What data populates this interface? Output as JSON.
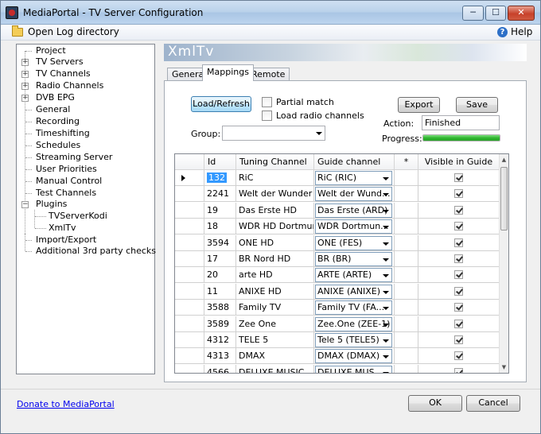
{
  "window": {
    "title": "MediaPortal - TV Server Configuration",
    "minimize": "─",
    "maximize": "☐",
    "close": "✕"
  },
  "toolbar": {
    "open_log": "Open Log directory",
    "help": "Help",
    "help_glyph": "?"
  },
  "tree": {
    "items": [
      {
        "label": "Project"
      },
      {
        "label": "TV Servers"
      },
      {
        "label": "TV Channels"
      },
      {
        "label": "Radio Channels"
      },
      {
        "label": "DVB EPG"
      },
      {
        "label": "General"
      },
      {
        "label": "Recording"
      },
      {
        "label": "Timeshifting"
      },
      {
        "label": "Schedules"
      },
      {
        "label": "Streaming Server"
      },
      {
        "label": "User Priorities"
      },
      {
        "label": "Manual Control"
      },
      {
        "label": "Test Channels"
      },
      {
        "label": "Plugins"
      },
      {
        "label": "TVServerKodi"
      },
      {
        "label": "XmlTv"
      },
      {
        "label": "Import/Export"
      },
      {
        "label": "Additional 3rd party checks"
      }
    ],
    "plus": "+",
    "minus": "−"
  },
  "section": {
    "title": "XmlTv"
  },
  "tabs": [
    {
      "label": "General"
    },
    {
      "label": "Mappings"
    },
    {
      "label": "Remote"
    }
  ],
  "mappings": {
    "load_refresh": "Load/Refresh",
    "partial_match": "Partial match",
    "load_radio": "Load radio channels",
    "export": "Export",
    "save": "Save",
    "group_label": "Group:",
    "group_value": "",
    "action_label": "Action:",
    "action_value": "Finished",
    "progress_label": "Progress:",
    "progress_percent": 100
  },
  "grid": {
    "columns": {
      "id": "Id",
      "tuning": "Tuning Channel",
      "guide": "Guide channel",
      "star": "*",
      "visible": "Visible in Guide"
    },
    "rows": [
      {
        "id": "132",
        "tuning": "RiC",
        "guide": "RiC (RIC)"
      },
      {
        "id": "2241",
        "tuning": "Welt der Wunder",
        "guide": "Welt der Wund..."
      },
      {
        "id": "19",
        "tuning": "Das Erste HD",
        "guide": "Das Erste (ARD)"
      },
      {
        "id": "18",
        "tuning": "WDR HD Dortmund",
        "guide": "WDR Dortmun..."
      },
      {
        "id": "3594",
        "tuning": "ONE HD",
        "guide": "ONE (FES)"
      },
      {
        "id": "17",
        "tuning": "BR Nord HD",
        "guide": "BR (BR)"
      },
      {
        "id": "20",
        "tuning": "arte HD",
        "guide": "ARTE (ARTE)"
      },
      {
        "id": "11",
        "tuning": "ANIXE HD",
        "guide": "ANIXE (ANIXE)"
      },
      {
        "id": "3588",
        "tuning": "Family TV",
        "guide": "Family TV (FA..."
      },
      {
        "id": "3589",
        "tuning": "Zee One",
        "guide": "Zee.One (ZEE-1)"
      },
      {
        "id": "4312",
        "tuning": "TELE 5",
        "guide": "Tele 5 (TELE5)"
      },
      {
        "id": "4313",
        "tuning": "DMAX",
        "guide": "DMAX (DMAX)"
      },
      {
        "id": "4566",
        "tuning": "DELUXE MUSIC",
        "guide": "DELUXE MUS..."
      }
    ]
  },
  "footer": {
    "donate": "Donate to MediaPortal",
    "ok": "OK",
    "cancel": "Cancel"
  },
  "colors": {
    "selection": "#3399ff",
    "progress": "#2fb52f",
    "link": "#0000ee"
  }
}
